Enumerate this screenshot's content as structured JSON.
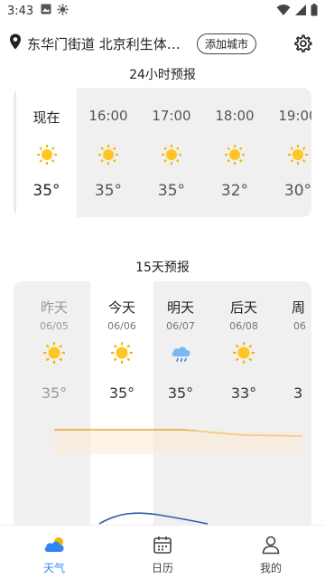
{
  "status_bar": {
    "time": "3:43"
  },
  "header": {
    "location": "东华门街道 北京利生体育商厦",
    "add_city_label": "添加城市"
  },
  "hourly": {
    "title": "24小时预报",
    "items": [
      {
        "label": "现在",
        "temp": "35°",
        "icon": "sun-icon"
      },
      {
        "label": "16:00",
        "temp": "35°",
        "icon": "sun-icon"
      },
      {
        "label": "17:00",
        "temp": "35°",
        "icon": "sun-icon"
      },
      {
        "label": "18:00",
        "temp": "32°",
        "icon": "sun-icon"
      },
      {
        "label": "19:00",
        "temp": "30°",
        "icon": "sun-icon"
      }
    ]
  },
  "daily": {
    "title": "15天预报",
    "items": [
      {
        "day": "昨天",
        "date": "06/05",
        "temp": "35°",
        "icon": "sun-icon"
      },
      {
        "day": "今天",
        "date": "06/06",
        "temp": "35°",
        "icon": "sun-icon"
      },
      {
        "day": "明天",
        "date": "06/07",
        "temp": "35°",
        "icon": "cloud-rain-icon"
      },
      {
        "day": "后天",
        "date": "06/08",
        "temp": "33°",
        "icon": "sun-icon"
      },
      {
        "day": "周",
        "date": "06",
        "temp": "3",
        "icon": "cloud-icon"
      }
    ],
    "colors": {
      "high_line": "#f0a030",
      "low_line": "#2b5ea8"
    }
  },
  "nav": {
    "items": [
      {
        "label": "天气",
        "icon": "cloud-sun-icon",
        "active": true
      },
      {
        "label": "日历",
        "icon": "calendar-icon",
        "active": false
      },
      {
        "label": "我的",
        "icon": "person-icon",
        "active": false
      }
    ],
    "accent": "#2f86f5"
  }
}
